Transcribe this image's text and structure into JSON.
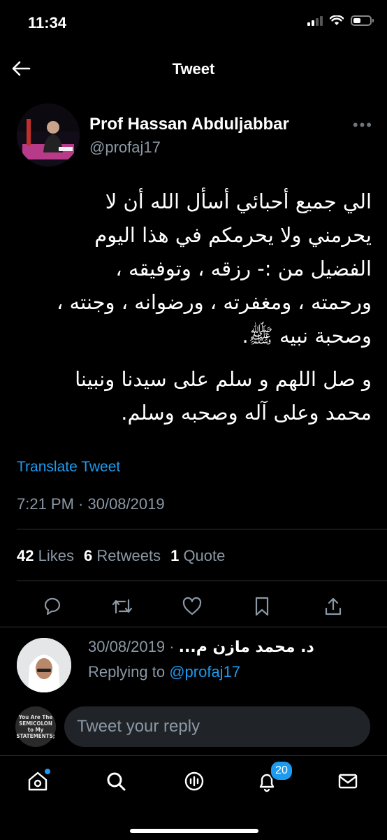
{
  "status_bar": {
    "time": "11:34"
  },
  "header": {
    "title": "Tweet"
  },
  "tweet": {
    "author_name": "Prof Hassan Abduljabbar",
    "author_handle": "@profaj17",
    "paragraphs": [
      "الي جميع أحبائي أسأل الله أن لا\nيحرمني ولا يحرمكم في هذا اليوم\nالفضيل من :- رزقه ، وتوفيقه ،\nورحمته ، ومغفرته ، ورضوانه ، وجنته ،\nوصحبة نبيه ﷺ.",
      "و صل اللهم و سلم على سيدنا ونبينا\nمحمد وعلى آله وصحبه وسلم."
    ],
    "translate_label": "Translate Tweet",
    "timestamp": "7:21 PM · 30/08/2019",
    "stats": {
      "likes_count": "42",
      "likes_label": "Likes",
      "retweets_count": "6",
      "retweets_label": "Retweets",
      "quotes_count": "1",
      "quotes_label": "Quote"
    }
  },
  "reply": {
    "name": "د. محمد مازن م...",
    "date": "30/08/2019",
    "replying_prefix": "Replying to",
    "replying_handle": "@profaj17"
  },
  "composer": {
    "placeholder": "Tweet your reply",
    "avatar_text": "You Are The SEMICOLON to My STATEMENTS;"
  },
  "tabbar": {
    "notifications_badge": "20"
  },
  "colors": {
    "accent": "#1d9bf0",
    "background": "#000000",
    "secondary_text": "#8b98a5"
  }
}
